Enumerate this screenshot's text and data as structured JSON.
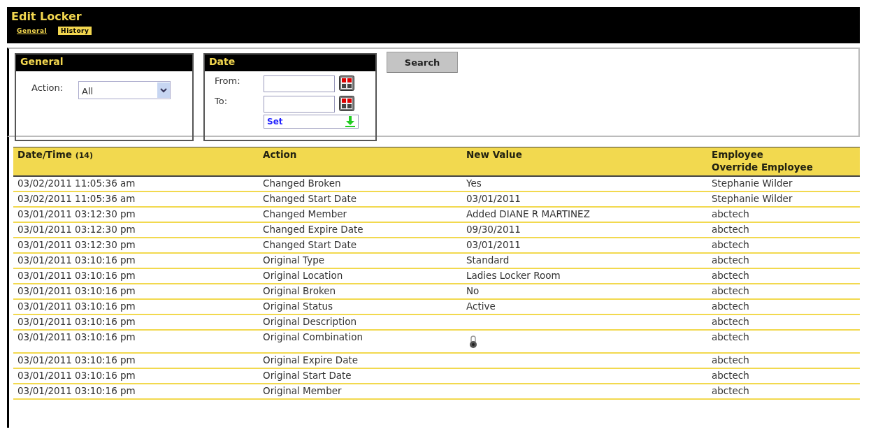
{
  "window": {
    "title": "Edit Locker"
  },
  "tabs": [
    {
      "label": "General",
      "selected": false
    },
    {
      "label": "History",
      "selected": true
    }
  ],
  "filters": {
    "general": {
      "title": "General",
      "action_label": "Action:",
      "action_value": "All"
    },
    "date": {
      "title": "Date",
      "from_label": "From:",
      "to_label": "To:",
      "set_label": "Set"
    },
    "search_button": "Search"
  },
  "table": {
    "columns": [
      {
        "label": "Date/Time",
        "count": "(14)"
      },
      {
        "label": "Action"
      },
      {
        "label": "New Value"
      },
      {
        "label": "Employee",
        "sub": "Override Employee"
      }
    ],
    "rows": [
      {
        "kind": "text",
        "date": "03/02/2011 11:05:36 am",
        "action": "Changed Broken",
        "new_value": "Yes",
        "employee": "Stephanie Wilder"
      },
      {
        "kind": "text",
        "date": "03/02/2011 11:05:36 am",
        "action": "Changed Start Date",
        "new_value": "03/01/2011",
        "employee": "Stephanie Wilder"
      },
      {
        "kind": "text",
        "date": "03/01/2011 03:12:30 pm",
        "action": "Changed Member",
        "new_value": "Added DIANE R MARTINEZ",
        "employee": "abctech"
      },
      {
        "kind": "text",
        "date": "03/01/2011 03:12:30 pm",
        "action": "Changed Expire Date",
        "new_value": "09/30/2011",
        "employee": "abctech"
      },
      {
        "kind": "text",
        "date": "03/01/2011 03:12:30 pm",
        "action": "Changed Start Date",
        "new_value": "03/01/2011",
        "employee": "abctech"
      },
      {
        "kind": "text",
        "date": "03/01/2011 03:10:16 pm",
        "action": "Original Type",
        "new_value": "Standard",
        "employee": "abctech"
      },
      {
        "kind": "text",
        "date": "03/01/2011 03:10:16 pm",
        "action": "Original Location",
        "new_value": "Ladies Locker Room",
        "employee": "abctech"
      },
      {
        "kind": "text",
        "date": "03/01/2011 03:10:16 pm",
        "action": "Original Broken",
        "new_value": "No",
        "employee": "abctech"
      },
      {
        "kind": "text",
        "date": "03/01/2011 03:10:16 pm",
        "action": "Original Status",
        "new_value": "Active",
        "employee": "abctech"
      },
      {
        "kind": "text",
        "date": "03/01/2011 03:10:16 pm",
        "action": "Original Description",
        "employee": "abctech"
      },
      {
        "kind": "lock",
        "date": "03/01/2011 03:10:16 pm",
        "action": "Original Combination",
        "employee": "abctech"
      },
      {
        "kind": "text",
        "date": "03/01/2011 03:10:16 pm",
        "action": "Original Expire Date",
        "employee": "abctech"
      },
      {
        "kind": "text",
        "date": "03/01/2011 03:10:16 pm",
        "action": "Original Start Date",
        "employee": "abctech"
      },
      {
        "kind": "text",
        "date": "03/01/2011 03:10:16 pm",
        "action": "Original Member",
        "employee": "abctech"
      }
    ]
  }
}
